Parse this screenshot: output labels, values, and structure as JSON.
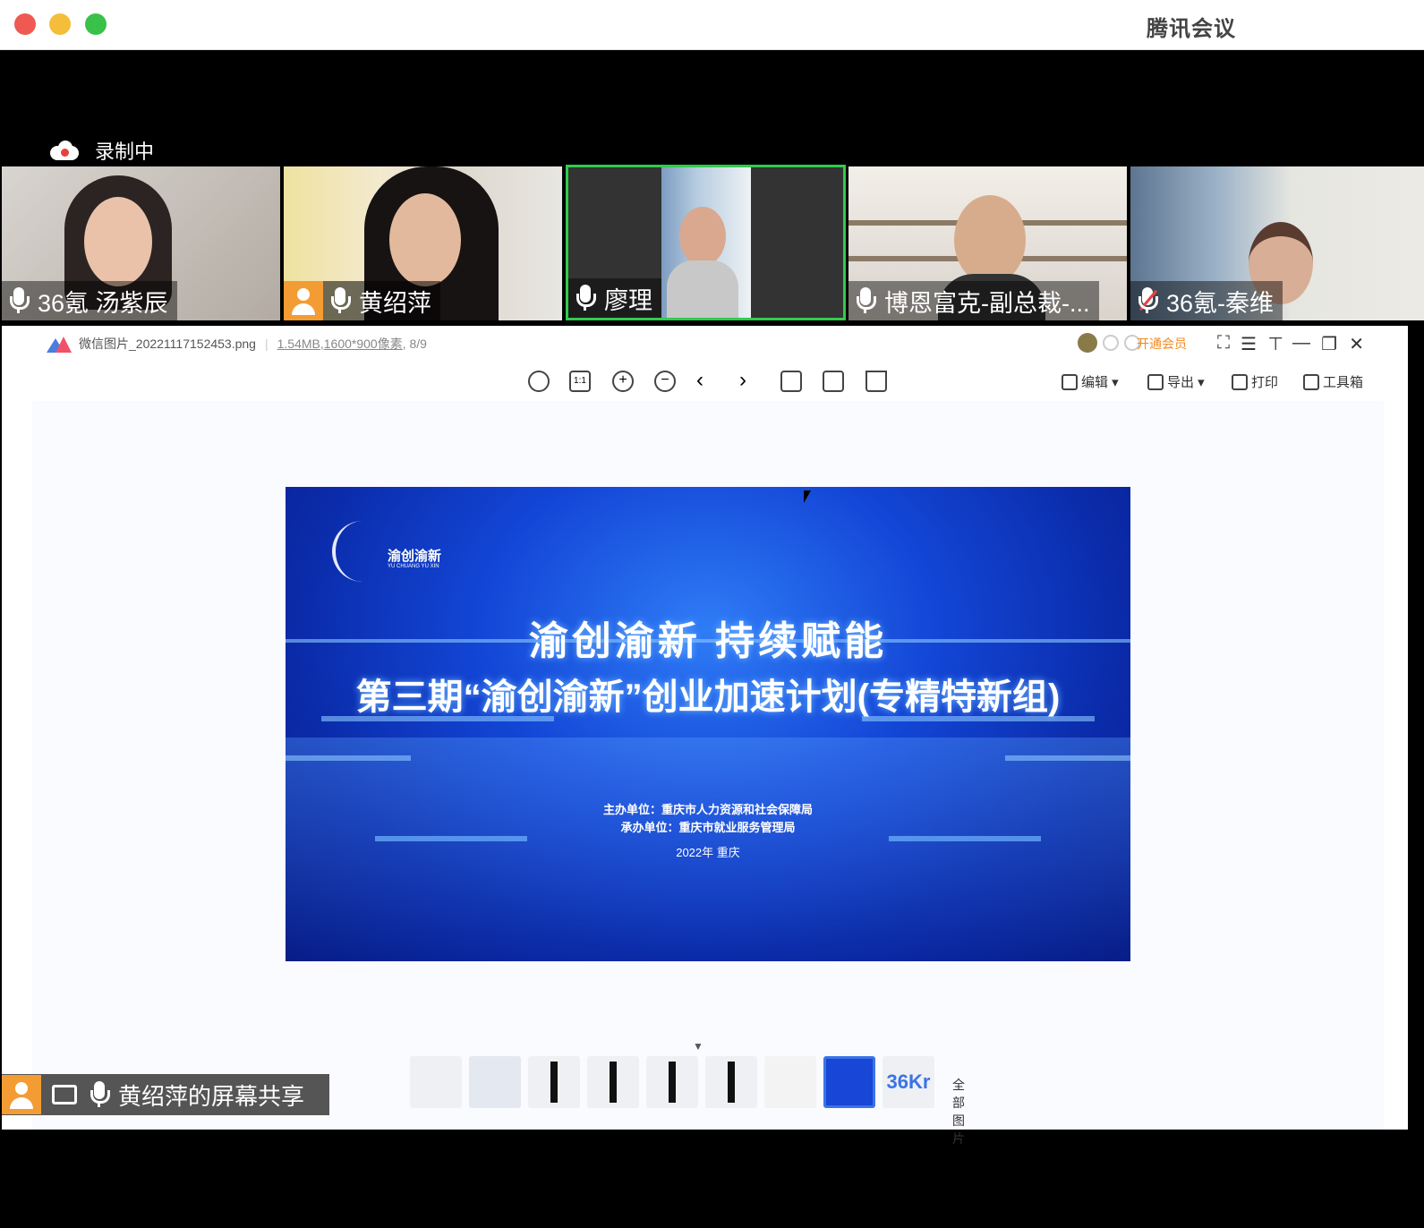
{
  "window": {
    "title": "腾讯会议"
  },
  "recording": {
    "label": "录制中"
  },
  "participants": [
    {
      "name": "36氪 汤紫辰",
      "muted": false
    },
    {
      "name": "黄绍萍",
      "muted": false
    },
    {
      "name": "廖理",
      "muted": false,
      "speaking": true
    },
    {
      "name": "博恩富克-副总裁-...",
      "muted": false
    },
    {
      "name": "36氪-秦维",
      "muted": true
    }
  ],
  "viewer": {
    "filename": "微信图片_20221117152453.png",
    "filesize": "1.54MB",
    "dimensions": ",1600*900像素",
    "position": ", 8/9",
    "vip": "开通会员",
    "actions": {
      "edit": "编辑",
      "export": "导出",
      "print": "打印",
      "toolbox": "工具箱"
    },
    "all_images": "全部图片"
  },
  "slide": {
    "brand": "渝创渝新",
    "brand_en": "YU CHUANG YU XIN",
    "title1": "渝创渝新 持续赋能",
    "title2": "第三期“渝创渝新”创业加速计划(专精特新组)",
    "host": "主办单位：重庆市人力资源和社会保障局",
    "organizer": "承办单位：重庆市就业服务管理局",
    "year": "2022年  重庆"
  },
  "thumbs": {
    "ninth": "36Kr"
  },
  "share": {
    "label": "黄绍萍的屏幕共享"
  },
  "colors": {
    "active_border": "#2fcc4c",
    "accent": "#3a73e6",
    "vip": "#f08a24"
  }
}
